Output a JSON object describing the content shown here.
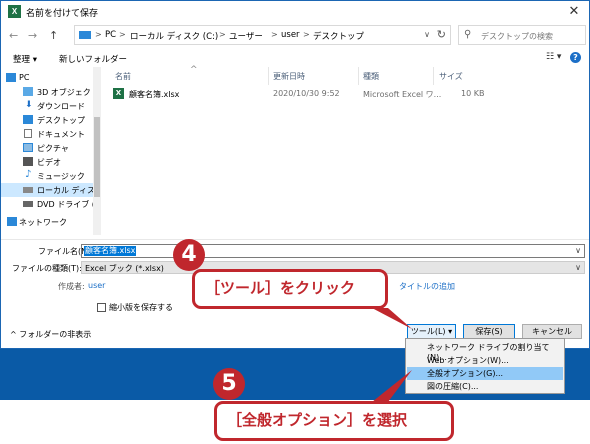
{
  "window": {
    "app_icon": "X",
    "title": "名前を付けて保存",
    "close_label": "✕"
  },
  "address_bar": {
    "back": "←",
    "forward": "→",
    "up": "↑",
    "crumbs": [
      "PC",
      "ローカル ディスク (C:)",
      "ユーザー",
      "user",
      "デスクトップ"
    ],
    "separator": ">",
    "dropdown": "∨",
    "refresh": "↻"
  },
  "search": {
    "placeholder": "デスクトップの検索"
  },
  "toolbar": {
    "organize": "整理 ▾",
    "new_folder": "新しいフォルダー",
    "view": "☷ ▾",
    "help": "?"
  },
  "nav_pane": {
    "items": [
      {
        "label": "PC",
        "icon": "pc-icon",
        "color": "#2b88d8"
      },
      {
        "label": "3D オブジェクト",
        "icon": "3d-objects-icon",
        "color": "#2b88d8"
      },
      {
        "label": "ダウンロード",
        "icon": "download-icon",
        "color": "#1c6fc7"
      },
      {
        "label": "デスクトップ",
        "icon": "desktop-icon",
        "color": "#2b88d8"
      },
      {
        "label": "ドキュメント",
        "icon": "documents-icon",
        "color": "#777777"
      },
      {
        "label": "ピクチャ",
        "icon": "pictures-icon",
        "color": "#2b88d8"
      },
      {
        "label": "ビデオ",
        "icon": "video-icon",
        "color": "#555555"
      },
      {
        "label": "ミュージック",
        "icon": "music-icon",
        "color": "#2b88d8"
      },
      {
        "label": "ローカル ディスク (C",
        "icon": "drive-icon",
        "color": "#888888"
      },
      {
        "label": "DVD ドライブ (D:)",
        "icon": "dvd-icon",
        "color": "#666666"
      },
      {
        "label": "ネットワーク",
        "icon": "network-icon",
        "color": "#2b88d8"
      }
    ]
  },
  "file_list": {
    "columns": [
      "名前",
      "更新日時",
      "種類",
      "サイズ"
    ],
    "sort_indicator": "^",
    "rows": [
      {
        "icon_letter": "X",
        "name": "顧客名簿.xlsx",
        "modified": "2020/10/30 9:52",
        "type": "Microsoft Excel ワ...",
        "size": "10 KB"
      }
    ]
  },
  "form": {
    "file_name_label": "ファイル名(N):",
    "file_name_value": "顧客名簿.xlsx",
    "file_type_label": "ファイルの種類(T):",
    "file_type_value": "Excel ブック (*.xlsx)",
    "author_label": "作成者:",
    "author_value": "user",
    "tags_link": "タイトルの追加",
    "thumbnail_label": "縮小版を保存する",
    "dropdown_arrow": "∨"
  },
  "footer": {
    "hide_folders": "^ フォルダーの非表示",
    "tools_button": "ツール(L)  ▾",
    "save_button": "保存(S)",
    "cancel_button": "キャンセル"
  },
  "tools_menu": {
    "items": [
      {
        "label": "ネットワーク ドライブの割り当て(N)..."
      },
      {
        "label": "Web オプション(W)..."
      },
      {
        "label": "全般オプション(G)..."
      },
      {
        "label": "図の圧縮(C)..."
      }
    ]
  },
  "callouts": {
    "step4_number": "4",
    "step4_text": "［ツール］をクリック",
    "step5_number": "5",
    "step5_text": "［全般オプション］を選択",
    "color": "#c0272d"
  }
}
